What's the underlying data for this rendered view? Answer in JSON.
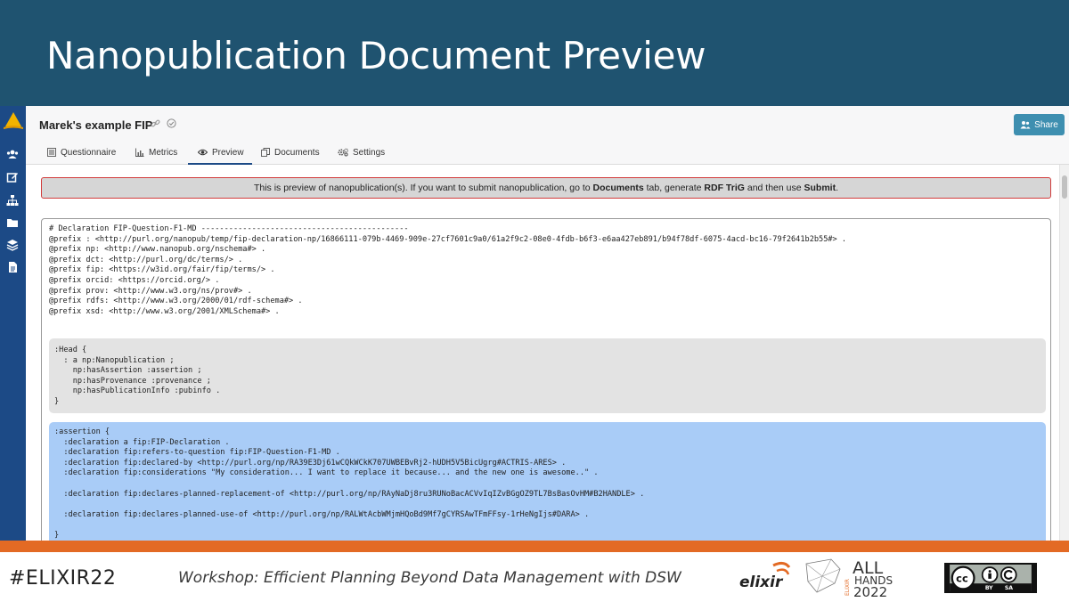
{
  "slide": {
    "title": "Nanopublication Document Preview"
  },
  "app": {
    "project_title": "Marek's example FIP",
    "share_label": "Share",
    "tabs": [
      {
        "label": "Questionnaire",
        "icon": "list-icon"
      },
      {
        "label": "Metrics",
        "icon": "chart-icon"
      },
      {
        "label": "Preview",
        "icon": "eye-icon",
        "active": true
      },
      {
        "label": "Documents",
        "icon": "copy-icon"
      },
      {
        "label": "Settings",
        "icon": "gears-icon"
      }
    ],
    "sidebar_icons": [
      "users-icon",
      "edit-icon",
      "sitemap-icon",
      "folder-icon",
      "layers-icon",
      "document-icon"
    ],
    "alert": {
      "text_1": "This is preview of nanopublication(s). If you want to submit nanopublication, go to ",
      "bold_1": "Documents",
      "text_2": " tab, generate ",
      "bold_2": "RDF TriG",
      "text_3": " and then use ",
      "bold_3": "Submit",
      "text_4": "."
    },
    "code": {
      "prefixes": "# Declaration FIP-Question-F1-MD ---------------------------------------------\n@prefix : <http://purl.org/nanopub/temp/fip-declaration-np/16866111-079b-4469-909e-27cf7601c9a0/61a2f9c2-08e0-4fdb-b6f3-e6aa427eb891/b94f78df-6075-4acd-bc16-79f2641b2b55#> .\n@prefix np: <http://www.nanopub.org/nschema#> .\n@prefix dct: <http://purl.org/dc/terms/> .\n@prefix fip: <https://w3id.org/fair/fip/terms/> .\n@prefix orcid: <https://orcid.org/> .\n@prefix prov: <http://www.w3.org/ns/prov#> .\n@prefix rdfs: <http://www.w3.org/2000/01/rdf-schema#> .\n@prefix xsd: <http://www.w3.org/2001/XMLSchema#> .",
      "head": ":Head {\n  : a np:Nanopublication ;\n    np:hasAssertion :assertion ;\n    np:hasProvenance :provenance ;\n    np:hasPublicationInfo :pubinfo .\n}",
      "assertion": ":assertion {\n  :declaration a fip:FIP-Declaration .\n  :declaration fip:refers-to-question fip:FIP-Question-F1-MD .\n  :declaration fip:declared-by <http://purl.org/np/RA39E3Dj61wCQkWCkK707UWBEBvRj2-hUDH5V5BicUgrg#ACTRIS-ARES> .\n  :declaration fip:considerations \"My consideration... I want to replace it because... and the new one is awesome..\" .\n\n  :declaration fip:declares-planned-replacement-of <http://purl.org/np/RAyNaDj8ru3RUNoBacACVvIqIZvBGgOZ9TL7BsBasOvHM#B2HANDLE> .\n\n  :declaration fip:declares-planned-use-of <http://purl.org/np/RALWtAcbWMjmHQoBd9Mf7gCYRSAwTFmFFsy-1rHeNgIjs#DARA> .\n\n}"
    }
  },
  "footer": {
    "hashtag": "#ELIXIR22",
    "workshop": "Workshop: Efficient Planning Beyond Data Management with DSW",
    "elixir_logo_text": "elixir",
    "allhands_line1": "ALL",
    "allhands_line2": "HANDS",
    "allhands_year": "2022",
    "allhands_vertical": "ELIXIR",
    "license": "BY SA",
    "license_by": "BY",
    "license_sa": "SA"
  }
}
